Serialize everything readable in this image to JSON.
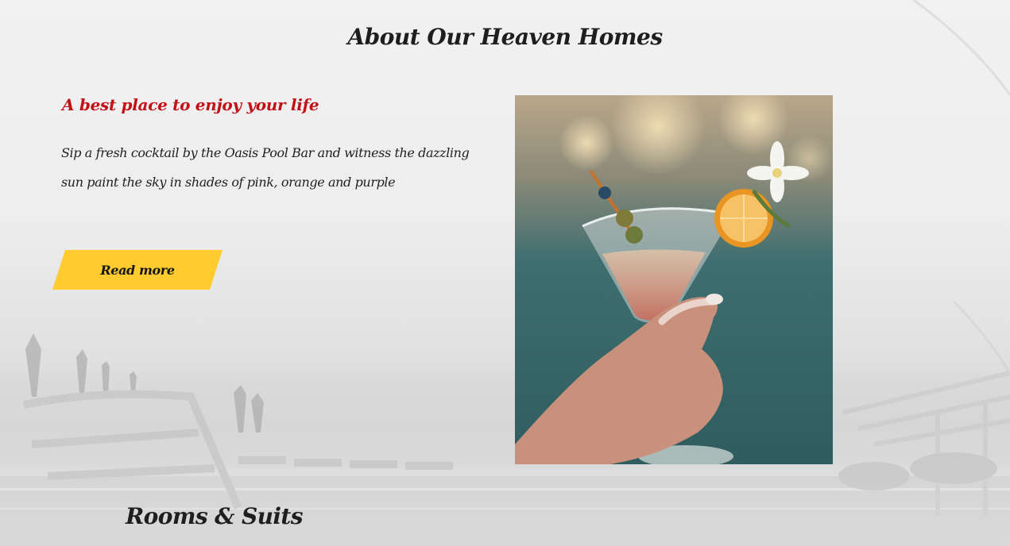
{
  "about": {
    "title": "About Our Heaven Homes",
    "tagline": "A best place to enjoy your life",
    "description": "Sip a fresh cocktail by the Oasis Pool Bar and witness the dazzling sun paint the sky in shades of pink, orange and purple",
    "read_more_label": "Read more",
    "image": "cocktail-glass-photo"
  },
  "rooms": {
    "title": "Rooms & Suits"
  },
  "colors": {
    "accent_red": "#c40f16",
    "button_yellow": "#ffcb2e",
    "text_dark": "#1e1e1e"
  }
}
